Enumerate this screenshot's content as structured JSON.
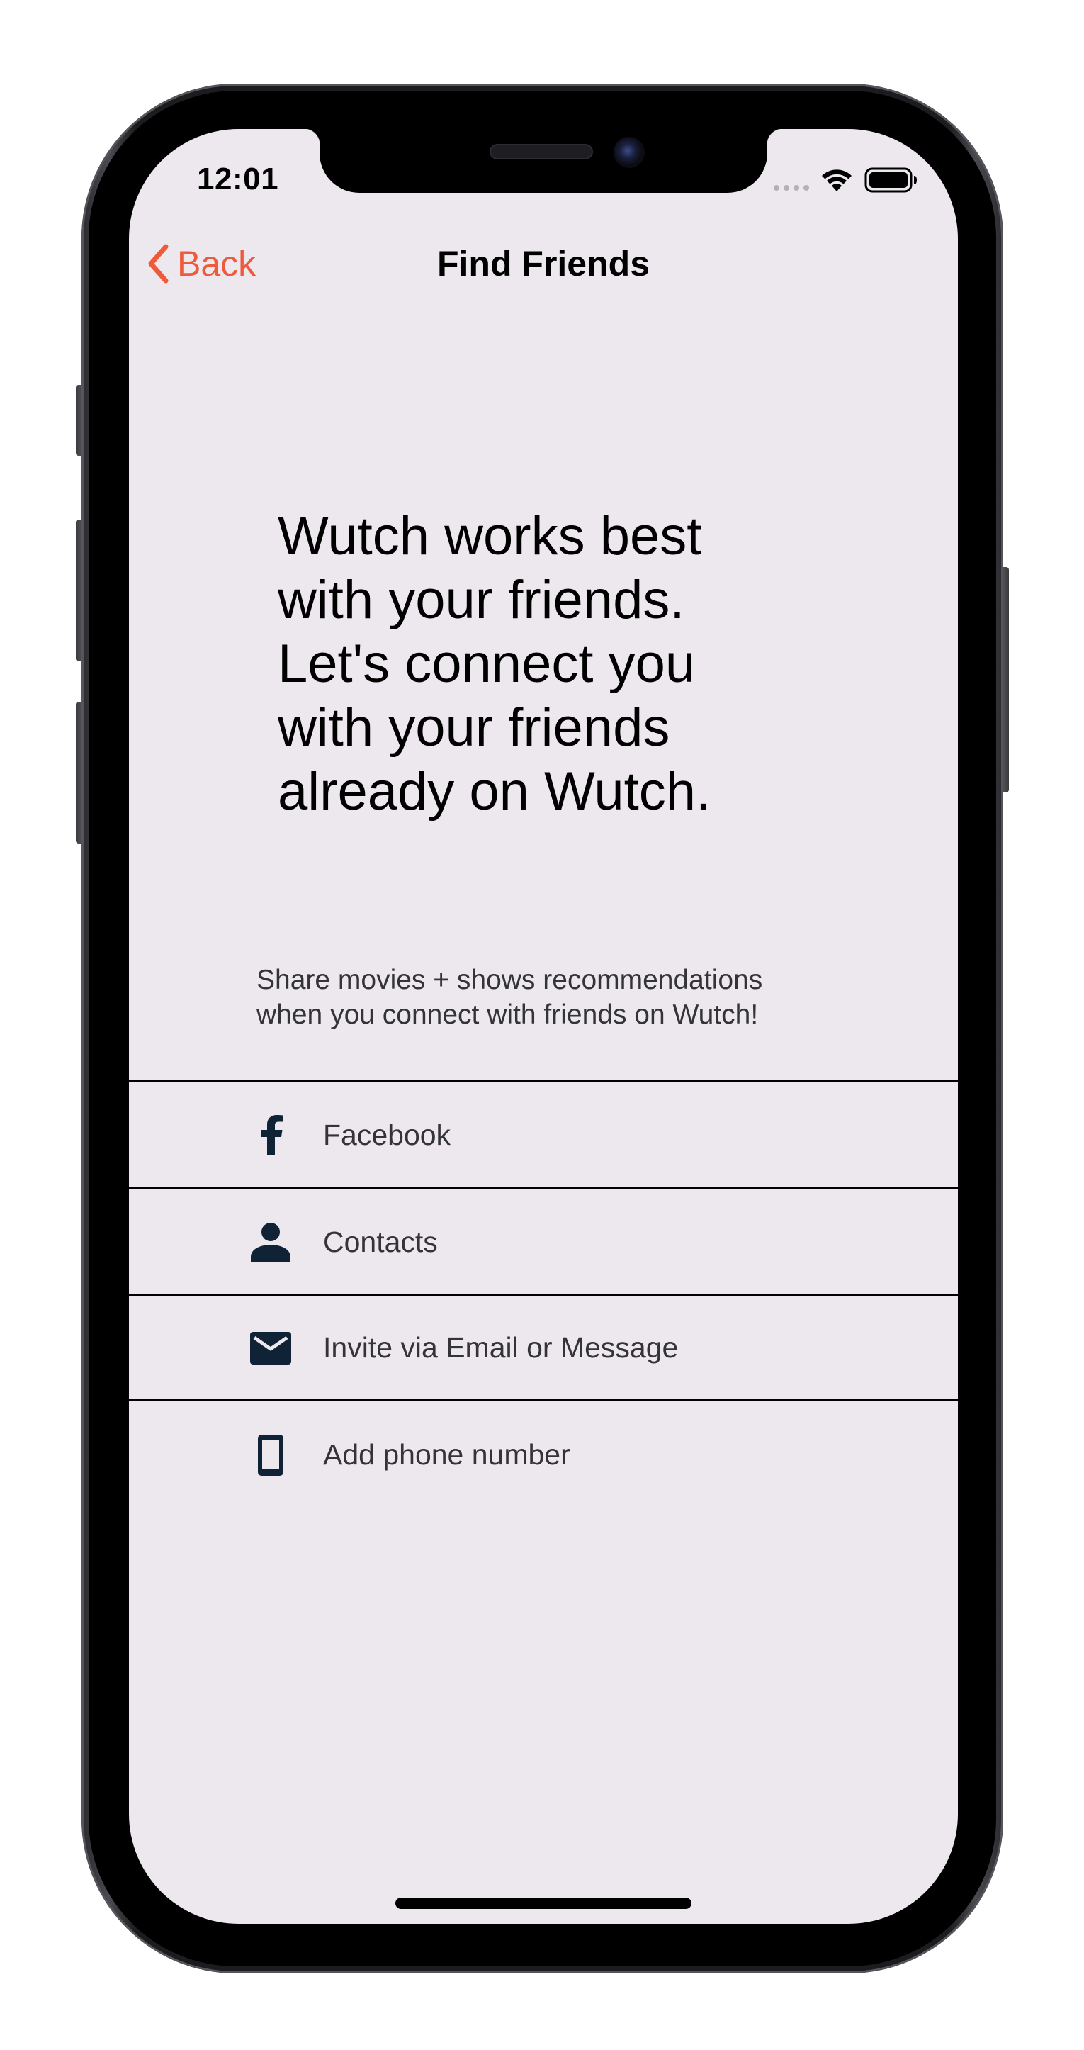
{
  "status_bar": {
    "time": "12:01",
    "icons": [
      "signal-icon",
      "wifi-icon",
      "battery-icon"
    ]
  },
  "nav": {
    "back_label": "Back",
    "title": "Find Friends"
  },
  "headline": {
    "lines": [
      "Wutch works best",
      "with your friends.",
      "Let's connect you",
      "with your friends",
      "already on Wutch."
    ]
  },
  "subtext": {
    "line1": "Share movies + shows recommendations",
    "line2": "when you connect with friends on Wutch!"
  },
  "options": [
    {
      "icon": "facebook-icon",
      "label": "Facebook"
    },
    {
      "icon": "person-icon",
      "label": "Contacts"
    },
    {
      "icon": "envelope-icon",
      "label": "Invite via Email or Message"
    },
    {
      "icon": "phone-icon",
      "label": "Add phone number"
    }
  ],
  "colors": {
    "accent": "#ee5a3c",
    "background": "#ece8ed",
    "icon": "#0f2236",
    "text": "#000000",
    "secondary_text": "#333338"
  }
}
